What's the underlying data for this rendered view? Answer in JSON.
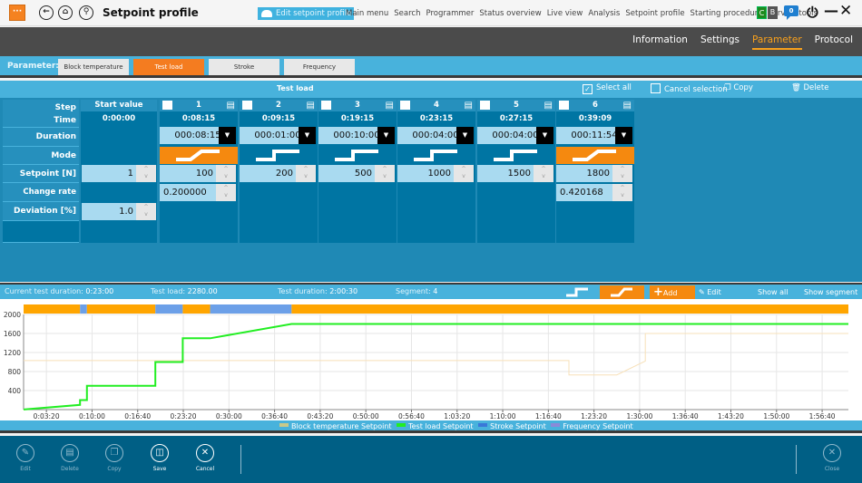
{
  "app": {
    "title": "Setpoint profile",
    "menu_icon": "ellipsis-icon",
    "edit_chip": "Edit setpoint profile",
    "nav_links": [
      "Main menu",
      "Search",
      "Programmer",
      "Status overview",
      "Live view",
      "Analysis",
      "Setpoint profile",
      "Starting procedure",
      "Service tools"
    ],
    "badge_c": "C",
    "badge_b": "B",
    "messages": "0"
  },
  "tabs": [
    {
      "label": "Information",
      "active": false
    },
    {
      "label": "Settings",
      "active": false
    },
    {
      "label": "Parameter",
      "active": true
    },
    {
      "label": "Protocol",
      "active": false
    }
  ],
  "parameter": {
    "label": "Parameter:",
    "buttons": [
      {
        "label": "Block temperature",
        "active": false
      },
      {
        "label": "Test load",
        "active": true
      },
      {
        "label": "Stroke",
        "active": false
      },
      {
        "label": "Frequency",
        "active": false
      }
    ]
  },
  "loadbar": {
    "title": "Test load",
    "select_all": "Select all",
    "cancel_selection": "Cancel selection",
    "copy": "Copy",
    "delete": "Delete"
  },
  "rows": {
    "step": "Step",
    "time": "Time",
    "duration": "Duration",
    "mode": "Mode",
    "setpoint": "Setpoint [N]",
    "change_rate": "Change rate [N/s]",
    "deviation": "Deviation [%]"
  },
  "start": {
    "label": "Start value",
    "time": "0:00:00",
    "setpoint": "1",
    "deviation": "1.0"
  },
  "steps": [
    {
      "num": "1",
      "time": "0:08:15",
      "duration": "000:08:15",
      "mode": "ramp",
      "setpoint": "100",
      "rate": "0.200000"
    },
    {
      "num": "2",
      "time": "0:09:15",
      "duration": "000:01:00",
      "mode": "step",
      "setpoint": "200",
      "rate": ""
    },
    {
      "num": "3",
      "time": "0:19:15",
      "duration": "000:10:00",
      "mode": "step",
      "setpoint": "500",
      "rate": ""
    },
    {
      "num": "4",
      "time": "0:23:15",
      "duration": "000:04:00",
      "mode": "step",
      "setpoint": "1000",
      "rate": ""
    },
    {
      "num": "5",
      "time": "0:27:15",
      "duration": "000:04:00",
      "mode": "step",
      "setpoint": "1500",
      "rate": ""
    },
    {
      "num": "6",
      "time": "0:39:09",
      "duration": "000:11:54",
      "mode": "ramp",
      "setpoint": "1800",
      "rate": "0.420168"
    }
  ],
  "info": {
    "current_label": "Current test duration:",
    "current_value": "0:23:00",
    "load_label": "Test load:",
    "load_value": "2280.00",
    "duration_label": "Test duration:",
    "duration_value": "2:00:30",
    "segment_label": "Segment:",
    "segment_value": "4",
    "add": "Add",
    "edit": "Edit",
    "show_all": "Show all",
    "show_segment": "Show segment"
  },
  "chart_data": {
    "type": "line",
    "x_unit": "seconds",
    "xlim": [
      0,
      7230
    ],
    "ylim": [
      0,
      2000
    ],
    "y_ticks": [
      400,
      800,
      1200,
      1600,
      2000
    ],
    "x_ticks": [
      "0:03:20",
      "0:10:00",
      "0:16:40",
      "0:23:20",
      "0:30:00",
      "0:36:40",
      "0:43:20",
      "0:50:00",
      "0:56:40",
      "1:03:20",
      "1:10:00",
      "1:16:40",
      "1:23:20",
      "1:30:00",
      "1:36:40",
      "1:43:20",
      "1:50:00",
      "1:56:40"
    ],
    "x_tick_seconds": [
      200,
      600,
      1000,
      1400,
      1800,
      2200,
      2600,
      3000,
      3400,
      3800,
      4200,
      4600,
      5000,
      5400,
      5800,
      6200,
      6600,
      7000
    ],
    "grid": true,
    "legend_position": "bottom",
    "series": [
      {
        "name": "Block temperature Setpoint",
        "color": "#f7e0b8",
        "points": [
          [
            0,
            1030
          ],
          [
            4780,
            1030
          ],
          [
            4780,
            730
          ],
          [
            5200,
            730
          ],
          [
            5450,
            1020
          ],
          [
            5450,
            1600
          ],
          [
            7230,
            1600
          ]
        ]
      },
      {
        "name": "Test load Setpoint",
        "color": "#22ee22",
        "points": [
          [
            0,
            1
          ],
          [
            495,
            100
          ],
          [
            495,
            200
          ],
          [
            555,
            200
          ],
          [
            555,
            500
          ],
          [
            1155,
            500
          ],
          [
            1155,
            1000
          ],
          [
            1395,
            1000
          ],
          [
            1395,
            1500
          ],
          [
            1635,
            1500
          ],
          [
            2349,
            1800
          ],
          [
            7230,
            1800
          ]
        ]
      },
      {
        "name": "Stroke Setpoint",
        "color": "#3a78d8",
        "points": []
      },
      {
        "name": "Frequency Setpoint",
        "color": "#8a8ad8",
        "points": []
      }
    ],
    "segments": [
      {
        "start": 0,
        "end": 495,
        "mode": "ramp",
        "color": "#ffa500"
      },
      {
        "start": 495,
        "end": 555,
        "mode": "step",
        "color": "#6ca0e8"
      },
      {
        "start": 555,
        "end": 1155,
        "mode": "ramp",
        "color": "#ffa500"
      },
      {
        "start": 1155,
        "end": 1395,
        "mode": "step",
        "color": "#6ca0e8"
      },
      {
        "start": 1395,
        "end": 1635,
        "mode": "ramp",
        "color": "#ffa500"
      },
      {
        "start": 1635,
        "end": 2349,
        "mode": "step",
        "color": "#6ca0e8"
      },
      {
        "start": 2349,
        "end": 7230,
        "mode": "ramp",
        "color": "#ffa500"
      }
    ]
  },
  "bottom": {
    "edit": "Edit",
    "delete": "Delete",
    "copy": "Copy",
    "save": "Save",
    "cancel": "Cancel",
    "close": "Close"
  }
}
